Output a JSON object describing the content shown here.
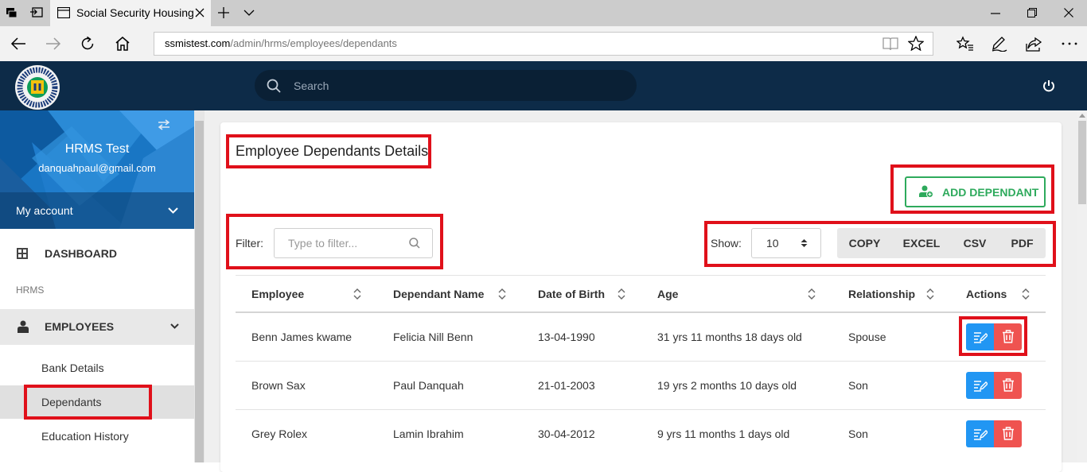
{
  "browser": {
    "tab_title": "Social Security Housing",
    "url_host": "ssmistest.com",
    "url_path": "/admin/hrms/employees/dependants"
  },
  "header": {
    "search_placeholder": "Search"
  },
  "sidebar": {
    "user_name": "HRMS Test",
    "user_email": "danquahpaul@gmail.com",
    "my_account": "My account",
    "dashboard": "DASHBOARD",
    "section": "HRMS",
    "employees": "EMPLOYEES",
    "subitems": [
      "Bank Details",
      "Dependants",
      "Education History"
    ]
  },
  "main": {
    "title": "Employee Dependants Details",
    "add_button": "ADD DEPENDANT",
    "filter_label": "Filter:",
    "filter_placeholder": "Type to filter...",
    "show_label": "Show:",
    "show_value": "10",
    "export_buttons": [
      "COPY",
      "EXCEL",
      "CSV",
      "PDF"
    ],
    "columns": [
      "Employee",
      "Dependant Name",
      "Date of Birth",
      "Age",
      "Relationship",
      "Actions"
    ],
    "rows": [
      {
        "employee": "Benn James kwame",
        "dependant": "Felicia Nill Benn",
        "dob": "13-04-1990",
        "age": "31 yrs 11 months 18 days old",
        "relationship": "Spouse"
      },
      {
        "employee": "Brown Sax",
        "dependant": "Paul Danquah",
        "dob": "21-01-2003",
        "age": "19 yrs 2 months 10 days old",
        "relationship": "Son"
      },
      {
        "employee": "Grey Rolex",
        "dependant": "Lamin Ibrahim",
        "dob": "30-04-2012",
        "age": "9 yrs 11 months 1 days old",
        "relationship": "Son"
      }
    ]
  },
  "colors": {
    "header_bg": "#0d2b48",
    "primary": "#2196f3",
    "danger": "#ef5350",
    "success": "#2eaa5c",
    "highlight": "#e0101a"
  }
}
